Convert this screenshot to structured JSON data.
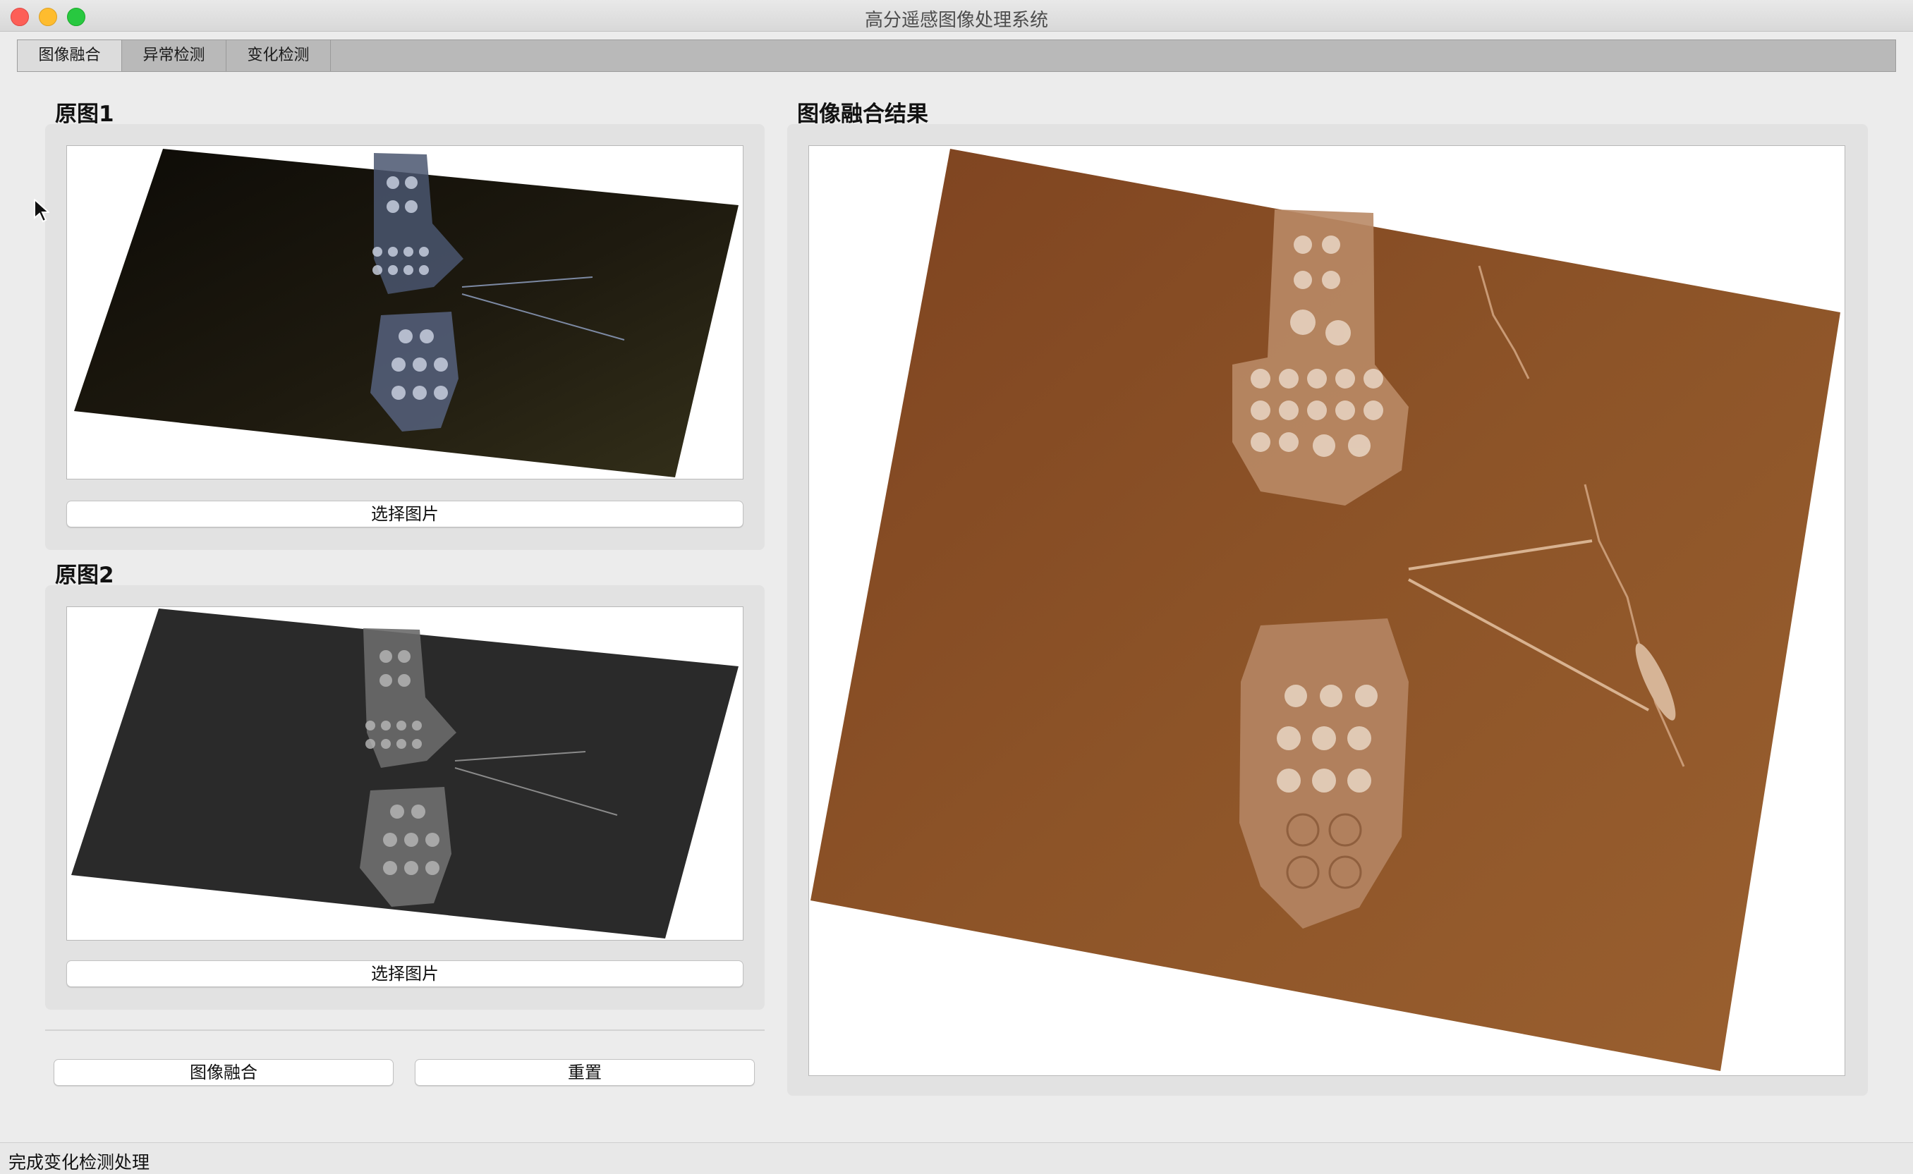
{
  "window": {
    "title": "高分遥感图像处理系统"
  },
  "tabs": [
    {
      "label": "图像融合",
      "active": true
    },
    {
      "label": "异常检测",
      "active": false
    },
    {
      "label": "变化检测",
      "active": false
    }
  ],
  "left_panel": {
    "source1": {
      "label": "原图1",
      "select_button": "选择图片"
    },
    "source2": {
      "label": "原图2",
      "select_button": "选择图片"
    },
    "fuse_button": "图像融合",
    "reset_button": "重置"
  },
  "right_panel": {
    "label": "图像融合结果"
  },
  "status": {
    "text": "完成变化检测处理"
  },
  "colors": {
    "image1_tone": "#231c0f",
    "image2_tone": "#2a2a2a",
    "result_tone": "#8a4f25"
  }
}
